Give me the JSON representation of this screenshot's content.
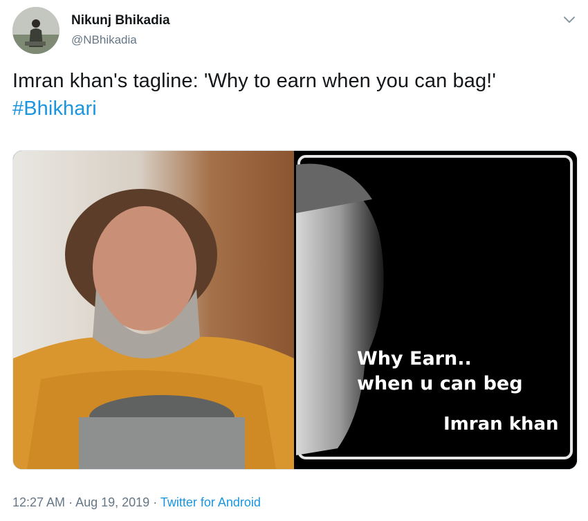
{
  "author": {
    "display_name": "Nikunj Bhikadia",
    "handle": "@NBhikadia",
    "avatar_icon": "profile-photo"
  },
  "tweet": {
    "text": "Imran khan's tagline: 'Why to earn when you can bag!'",
    "hashtag": "#Bhikhari"
  },
  "media": {
    "quote_line1": "Why Earn..",
    "quote_line2": "when u can beg",
    "signature": "Imran khan"
  },
  "meta": {
    "time": "12:27 AM",
    "separator": " · ",
    "date": "Aug 19, 2019",
    "source": "Twitter for Android"
  },
  "colors": {
    "link": "#1b95e0",
    "secondary_text": "#657786",
    "primary_text": "#14171a"
  },
  "icons": {
    "menu": "chevron-down-icon"
  }
}
